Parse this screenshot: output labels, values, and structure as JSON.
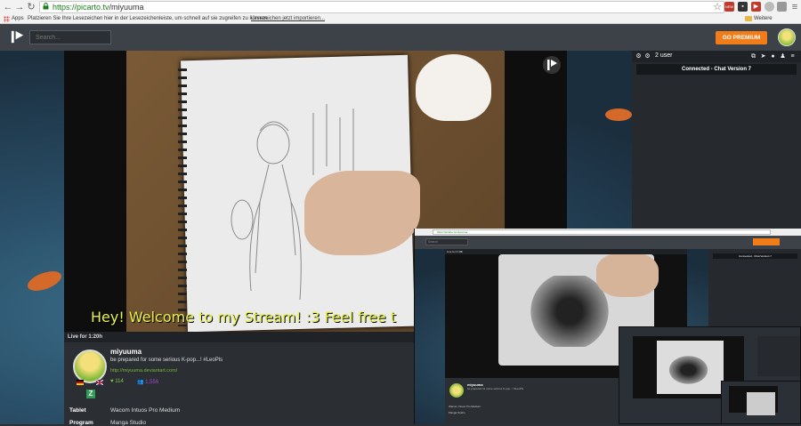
{
  "browser": {
    "url_host": "https://picarto.tv",
    "url_path": "/miyuuma",
    "bookmarks_apps": "Apps",
    "bookmarks_hint": "Platzieren Sie Ihre Lesezeichen hier in der Lesezeichenleiste, um schnell auf sie zugreifen zu können.",
    "bookmarks_import": "Lesezeichen jetzt importieren...",
    "bookmarks_other": "Weitere Lesezeichen",
    "ext_badge": "NEW"
  },
  "header": {
    "search_placeholder": "Search...",
    "premium_label": "GO PREMIUM"
  },
  "video": {
    "overlay_text": "Hey! Welcome to my Stream! :3 Feel free t",
    "live_status": "Live for 1:20h"
  },
  "profile": {
    "name": "miyuuma",
    "description": "be prepared for some serious K-pop...! #LeoPls",
    "link": "http://miyuuma.deviantart.com/",
    "hearts": "114",
    "views": "1,556"
  },
  "info": [
    {
      "label": "Tablet",
      "value": "Wacom Intuos Pro Medium"
    },
    {
      "label": "Program",
      "value": "Manga Studio"
    }
  ],
  "chat": {
    "user_count": "2 user",
    "connected": "Connected - Chat Version 7"
  },
  "nested": {
    "url": "https://picarto.tv/miyuuma",
    "search_placeholder": "Search",
    "live_status": "Live for 0:48h",
    "name": "miyuuma",
    "connected": "Connected - Chat Version 7",
    "info_tablet": "Wacom Intuos Pro Medium",
    "info_program": "Manga Studio"
  },
  "colors": {
    "accent": "#f07d1a",
    "hearts": "#7ac943",
    "views": "#9a4bc9",
    "link": "#79b83a"
  }
}
